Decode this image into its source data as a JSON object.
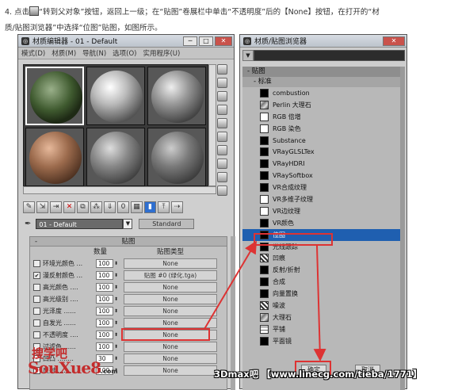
{
  "caption": {
    "line1_pre": "4. 点击",
    "line1_post": "“转到父对象”按钮，返回上一级；在“贴图”卷展栏中单击“不透明度”后的【None】按钮，在打开的“材",
    "line2": "质/贴图浏览器”中选择“位图”贴图，如图所示。"
  },
  "material_editor": {
    "title": "材质编辑器 - 01 - Default",
    "menu": [
      "模式(D)",
      "材质(M)",
      "导航(N)",
      "选项(O)",
      "实用程序(U)"
    ],
    "material_name": "01 - Default",
    "type_button": "Standard",
    "maps_rollout": {
      "title": "贴图",
      "col_amount": "数量",
      "col_type": "贴图类型",
      "rows": [
        {
          "label": "环境光颜色 ...",
          "amount": "100",
          "map": "None",
          "checked": false
        },
        {
          "label": "漫反射颜色 ...",
          "amount": "100",
          "map": "贴图 #0 (绿化.tga)",
          "checked": true
        },
        {
          "label": "高光颜色 ....",
          "amount": "100",
          "map": "None",
          "checked": false
        },
        {
          "label": "高光级别 ....",
          "amount": "100",
          "map": "None",
          "checked": false
        },
        {
          "label": "光泽度 ......",
          "amount": "100",
          "map": "None",
          "checked": false
        },
        {
          "label": "自发光 ......",
          "amount": "100",
          "map": "None",
          "checked": false
        },
        {
          "label": "不透明度 ....",
          "amount": "100",
          "map": "None",
          "checked": false
        },
        {
          "label": "过滤色 ......",
          "amount": "100",
          "map": "None",
          "checked": false
        },
        {
          "label": "凹凸 ........",
          "amount": "30",
          "map": "None",
          "checked": false
        },
        {
          "label": "反射 ........",
          "amount": "100",
          "map": "None",
          "checked": false
        }
      ]
    }
  },
  "browser": {
    "title": "材质/贴图浏览器",
    "group": "- 贴图",
    "subgroup": "- 标准",
    "items": [
      {
        "name": "combustion",
        "icon": "black"
      },
      {
        "name": "Perlin 大理石",
        "icon": "marble"
      },
      {
        "name": "RGB 倍增",
        "icon": "white"
      },
      {
        "name": "RGB 染色",
        "icon": "white"
      },
      {
        "name": "Substance",
        "icon": "black"
      },
      {
        "name": "VRayGLSLTex",
        "icon": "black"
      },
      {
        "name": "VRayHDRI",
        "icon": "black"
      },
      {
        "name": "VRaySoftbox",
        "icon": "black"
      },
      {
        "name": "VR合成纹理",
        "icon": "black"
      },
      {
        "name": "VR多维子纹理",
        "icon": "white"
      },
      {
        "name": "VR边纹理",
        "icon": "white"
      },
      {
        "name": "VR颜色",
        "icon": "black"
      },
      {
        "name": "位图",
        "icon": "black",
        "selected": true
      },
      {
        "name": "光线跟踪",
        "icon": "black"
      },
      {
        "name": "凹痕",
        "icon": "noise"
      },
      {
        "name": "反射/折射",
        "icon": "black"
      },
      {
        "name": "合成",
        "icon": "black"
      },
      {
        "name": "向量置换",
        "icon": "black"
      },
      {
        "name": "噪波",
        "icon": "noise"
      },
      {
        "name": "大理石",
        "icon": "marble"
      },
      {
        "name": "平铺",
        "icon": "tile"
      },
      {
        "name": "平面镜",
        "icon": "black"
      }
    ],
    "ok_button": "确定",
    "cancel_button": "取消"
  },
  "logo": {
    "line1": "搜学吧",
    "line2": "SouXue8",
    "domain": ".com"
  },
  "watermark": "3Dmax吧 【www.linecg.com/tieba/1771】",
  "colors": {
    "selection": "#1f5fb0",
    "highlight": "#d33333",
    "logo": "#c42c2c"
  }
}
